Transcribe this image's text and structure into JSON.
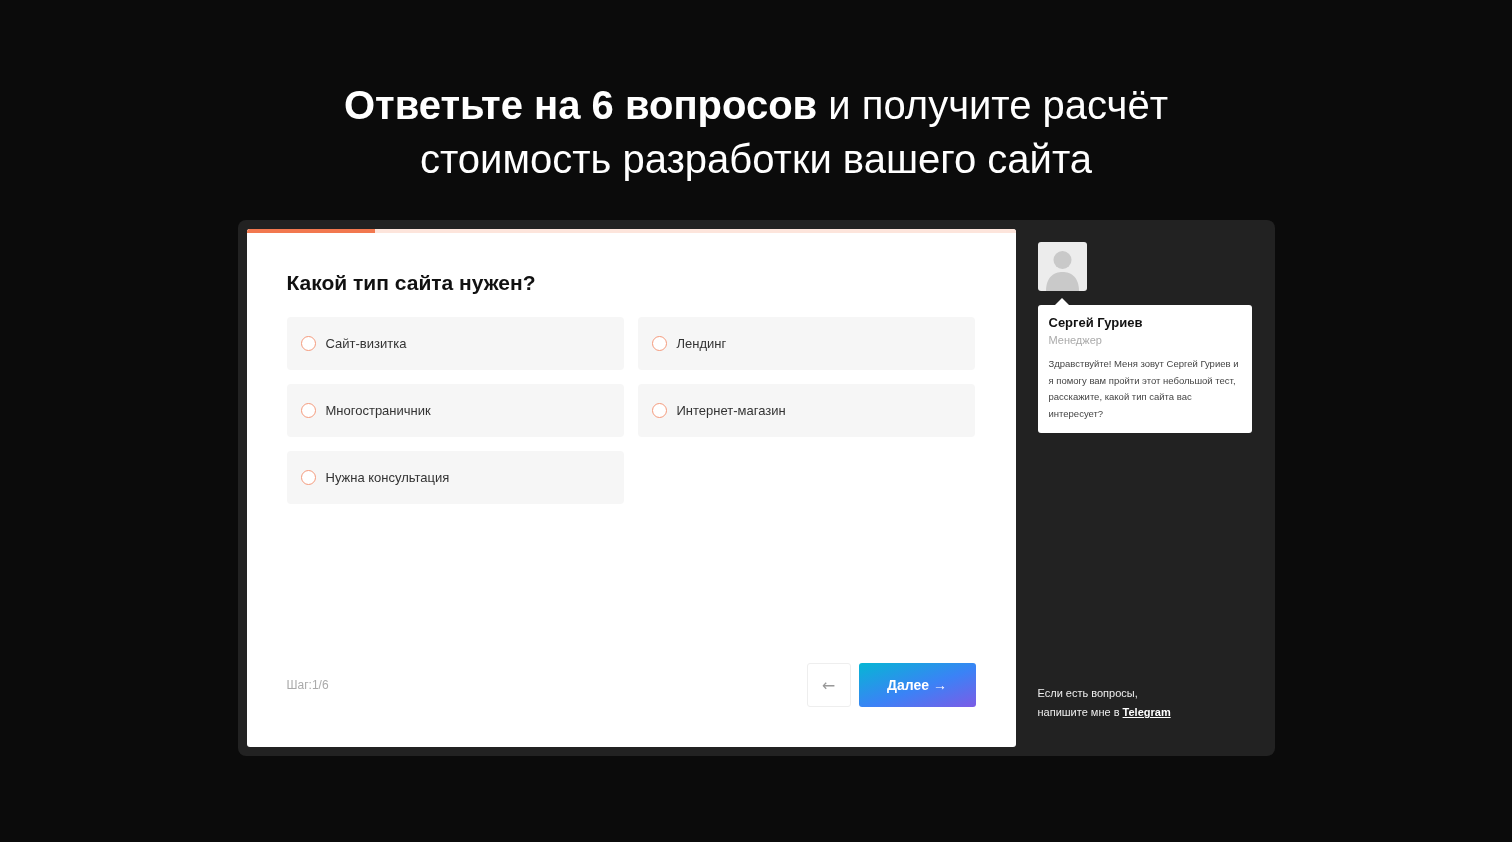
{
  "heading": "**Ответьте на 6 вопросов** и получите расчёт стоимость разработки вашего сайта",
  "quiz": {
    "progress": {
      "level": 0.167
    },
    "question": "Какой тип сайта нужен?",
    "options": [
      {
        "label": "Сайт-визитка",
        "selected": false
      },
      {
        "label": "Лендинг",
        "selected": false
      },
      {
        "label": "Многостраничник",
        "selected": false
      },
      {
        "label": "Интернет-магазин",
        "selected": false
      },
      {
        "label": "Нужна консультация",
        "selected": false
      }
    ],
    "step": "Шаг:1/6",
    "back_button": "←",
    "next_button": "Далее →"
  },
  "manager": {
    "name": "Сергей Гуриев",
    "role": "Менеджер",
    "message": "Здравствуйте! Меня зовут Сергей Гуриев и я помогу вам пройти этот небольшой тест, расскажите, какой тип сайта вас интересует?",
    "contact_text": "Если есть вопросы, напишите мне в",
    "contact_link": "Telegram"
  }
}
